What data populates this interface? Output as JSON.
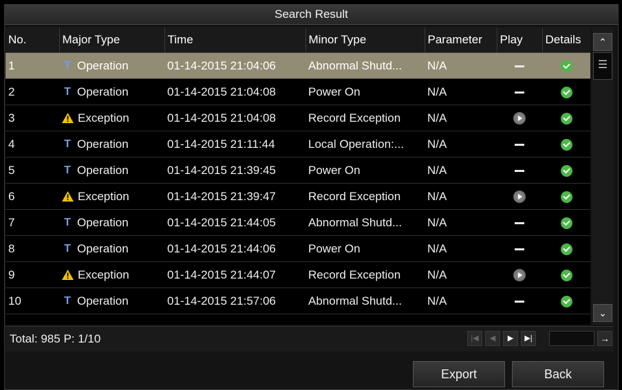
{
  "window": {
    "title": "Search Result"
  },
  "columns": [
    "No.",
    "Major Type",
    "Time",
    "Minor Type",
    "Parameter",
    "Play",
    "Details"
  ],
  "rows": [
    {
      "no": "1",
      "type_icon": "tool-icon",
      "major": "Operation",
      "time": "01-14-2015 21:04:06",
      "minor": "Abnormal Shutd...",
      "param": "N/A",
      "play": "none",
      "details": "ok"
    },
    {
      "no": "2",
      "type_icon": "tool-icon",
      "major": "Operation",
      "time": "01-14-2015 21:04:08",
      "minor": "Power On",
      "param": "N/A",
      "play": "none",
      "details": "ok"
    },
    {
      "no": "3",
      "type_icon": "warning-icon",
      "major": "Exception",
      "time": "01-14-2015 21:04:08",
      "minor": "Record Exception",
      "param": "N/A",
      "play": "play",
      "details": "ok"
    },
    {
      "no": "4",
      "type_icon": "tool-icon",
      "major": "Operation",
      "time": "01-14-2015 21:11:44",
      "minor": "Local Operation:...",
      "param": "N/A",
      "play": "none",
      "details": "ok"
    },
    {
      "no": "5",
      "type_icon": "tool-icon",
      "major": "Operation",
      "time": "01-14-2015 21:39:45",
      "minor": "Power On",
      "param": "N/A",
      "play": "none",
      "details": "ok"
    },
    {
      "no": "6",
      "type_icon": "warning-icon",
      "major": "Exception",
      "time": "01-14-2015 21:39:47",
      "minor": "Record Exception",
      "param": "N/A",
      "play": "play",
      "details": "ok"
    },
    {
      "no": "7",
      "type_icon": "tool-icon",
      "major": "Operation",
      "time": "01-14-2015 21:44:05",
      "minor": "Abnormal Shutd...",
      "param": "N/A",
      "play": "none",
      "details": "ok"
    },
    {
      "no": "8",
      "type_icon": "tool-icon",
      "major": "Operation",
      "time": "01-14-2015 21:44:06",
      "minor": "Power On",
      "param": "N/A",
      "play": "none",
      "details": "ok"
    },
    {
      "no": "9",
      "type_icon": "warning-icon",
      "major": "Exception",
      "time": "01-14-2015 21:44:07",
      "minor": "Record Exception",
      "param": "N/A",
      "play": "play",
      "details": "ok"
    },
    {
      "no": "10",
      "type_icon": "tool-icon",
      "major": "Operation",
      "time": "01-14-2015 21:57:06",
      "minor": "Abnormal Shutd...",
      "param": "N/A",
      "play": "none",
      "details": "ok"
    }
  ],
  "selected_row": 0,
  "footer": {
    "total_text": "Total: 985  P: 1/10",
    "page_input_value": ""
  },
  "buttons": {
    "export": "Export",
    "back": "Back"
  },
  "colors": {
    "selected_row": "#938c74",
    "ok_icon": "#4cb848",
    "operation_icon": "#6fa0e0",
    "warning_icon": "#f2c200"
  }
}
